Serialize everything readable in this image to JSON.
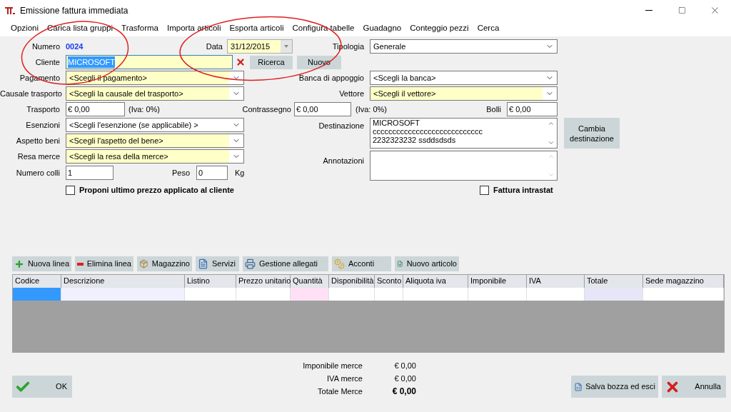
{
  "window": {
    "title": "Emissione fattura immediata"
  },
  "menu": [
    "Opzioni",
    "Carica lista gruppi",
    "Trasforma",
    "Importa articoli",
    "Esporta articoli",
    "Configura tabelle",
    "Guadagno",
    "Conteggio pezzi",
    "Cerca"
  ],
  "numero": {
    "label": "Numero",
    "value": "0024"
  },
  "data": {
    "label": "Data",
    "value": "31/12/2015",
    "highlighted": true
  },
  "tipologia": {
    "label": "Tipologia",
    "value": "Generale",
    "highlighted": false
  },
  "cliente": {
    "label": "Cliente",
    "value": "MICROSOFT",
    "highlighted": true,
    "text_selected": true,
    "buttons": [
      "Ricerca",
      "Nuovo"
    ]
  },
  "pagamento": {
    "label": "Pagamento",
    "value": "<Scegli il pagamento>",
    "highlighted": true
  },
  "banca": {
    "label": "Banca di appoggio",
    "value": "<Scegli la banca>",
    "highlighted": false
  },
  "causale": {
    "label": "Causale trasporto",
    "value": "<Scegli la causale del trasporto>",
    "highlighted": true
  },
  "vettore": {
    "label": "Vettore",
    "value": "<Scegli il vettore>",
    "highlighted": true
  },
  "trasporto": {
    "label": "Trasporto",
    "value": "€ 0,00",
    "note": "(Iva: 0%)"
  },
  "contrassegno": {
    "label": "Contrassegno",
    "value": "€ 0,00",
    "note": "(Iva: 0%)"
  },
  "bolli": {
    "label": "Bolli",
    "value": "€ 0,00"
  },
  "esenzioni": {
    "label": "Esenzioni",
    "value": "<Scegli l'esenzione (se applicabile) >",
    "highlighted": false
  },
  "aspetto": {
    "label": "Aspetto beni",
    "value": "<Scegli l'aspetto del bene>",
    "highlighted": true
  },
  "resa": {
    "label": "Resa merce",
    "value": "<Scegli la resa della merce>",
    "highlighted": true
  },
  "colli": {
    "label": "Numero colli",
    "value": "1"
  },
  "peso": {
    "label": "Peso",
    "value": "0",
    "unit": "Kg"
  },
  "destinazione": {
    "label": "Destinazione",
    "lines": [
      "MICROSOFT",
      "cccccccccccccccccccccccccccc",
      "2232323232 ssddsdsds"
    ],
    "button": "Cambia destinazione"
  },
  "annotazioni": {
    "label": "Annotazioni"
  },
  "checkboxes": [
    {
      "label": "Proponi ultimo prezzo applicato al cliente",
      "checked": false
    },
    {
      "label": "Fattura intrastat",
      "checked": false
    }
  ],
  "toolbar": [
    "Nuova linea",
    "Elimina linea",
    "Magazzino",
    "Servizi",
    "Gestione allegati",
    "Acconti",
    "Nuovo articolo"
  ],
  "table": {
    "columns": [
      {
        "label": "Codice",
        "color": "#3399ff"
      },
      {
        "label": "Descrizione",
        "color": "#f0f0ff"
      },
      {
        "label": "Listino",
        "color": "#ffffff"
      },
      {
        "label": "Prezzo unitario",
        "color": "#ffffff"
      },
      {
        "label": "Quantità",
        "color": "#ffe0f5"
      },
      {
        "label": "Disponibilità",
        "color": "#ffffff"
      },
      {
        "label": "Sconto",
        "color": "#ffffff"
      },
      {
        "label": "Aliquota iva",
        "color": "#ffffff"
      },
      {
        "label": "Imponibile",
        "color": "#ffffff"
      },
      {
        "label": "IVA",
        "color": "#ffffff"
      },
      {
        "label": "Totale",
        "color": "#e6e6f8"
      },
      {
        "label": "Sede magazzino",
        "color": "#ffffff"
      }
    ]
  },
  "totals": [
    {
      "label": "Imponibile merce",
      "value": "€ 0,00",
      "emphasized": false
    },
    {
      "label": "IVA merce",
      "value": "€ 0,00",
      "emphasized": false
    },
    {
      "label": "Totale Merce",
      "value": "€ 0,00",
      "emphasized": true
    }
  ],
  "buttons": {
    "ok": "OK",
    "save": "Salva bozza ed esci",
    "cancel": "Annulla"
  }
}
